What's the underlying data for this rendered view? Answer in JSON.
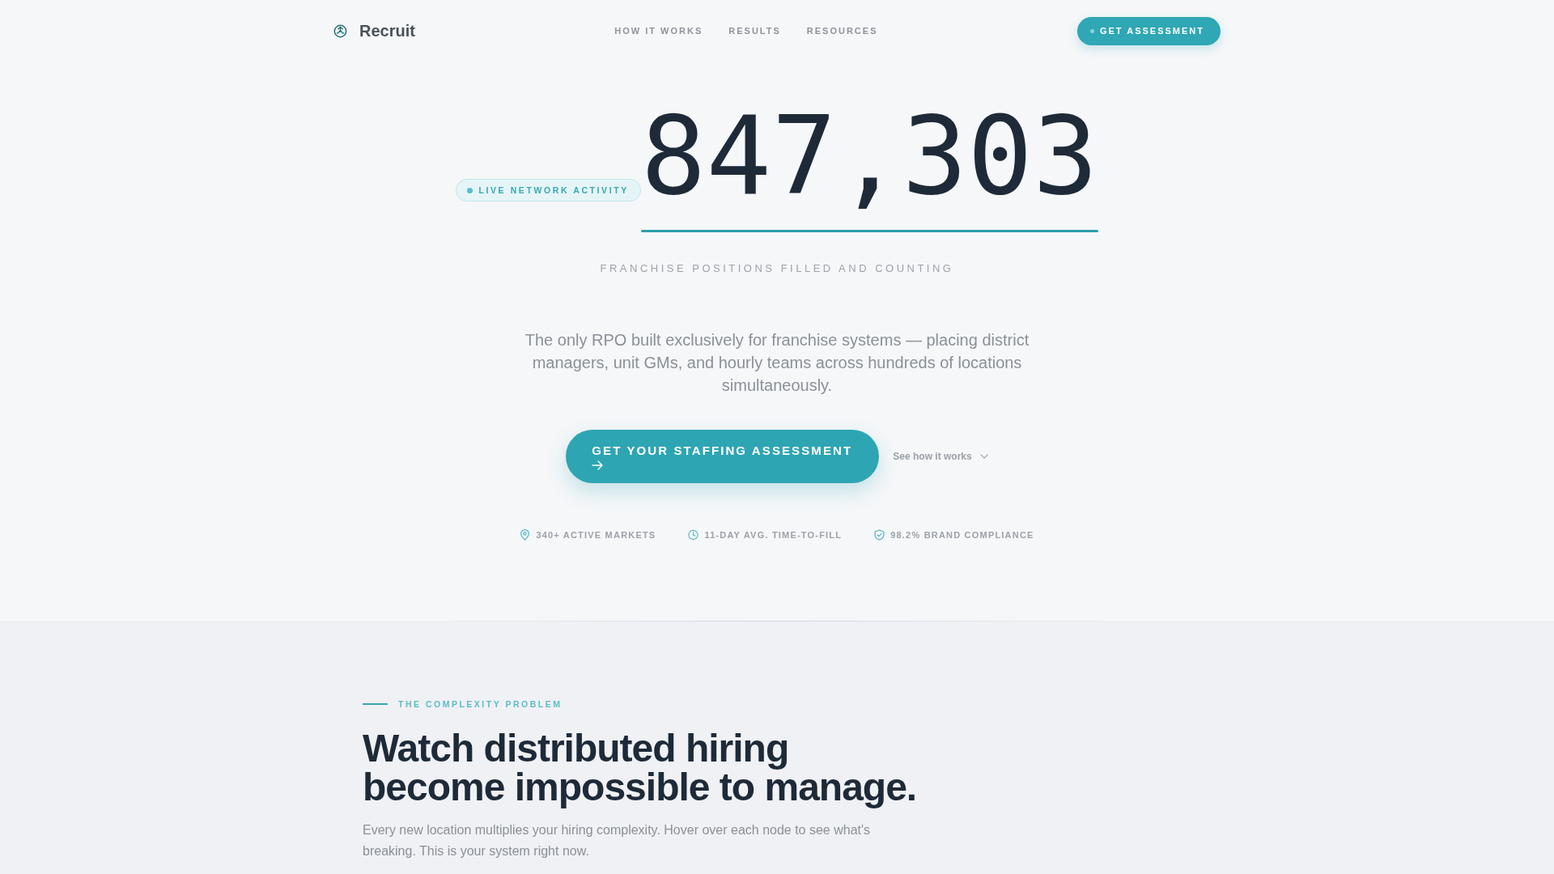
{
  "header": {
    "logo": "Recruit",
    "nav": [
      "HOW IT WORKS",
      "RESULTS",
      "RESOURCES"
    ],
    "cta": "GET ASSESSMENT"
  },
  "hero": {
    "badge": "LIVE NETWORK ACTIVITY",
    "counter": "847,303",
    "caption": "FRANCHISE POSITIONS FILLED AND COUNTING",
    "intro": "The only RPO built exclusively for franchise systems — placing district managers, unit GMs, and hourly teams across hundreds of locations simultaneously.",
    "primary_button": "GET YOUR STAFFING ASSESSMENT",
    "secondary_link": "See how it works",
    "stats": [
      "340+ ACTIVE MARKETS",
      "11-DAY AVG. TIME-TO-FILL",
      "98.2% BRAND COMPLIANCE"
    ]
  },
  "section": {
    "eyebrow": "THE COMPLEXITY PROBLEM",
    "heading": "Watch distributed hiring become impossible to manage.",
    "text": "Every new location multiplies your hiring complexity. Hover over each node to see what's breaking. This is your system right now."
  }
}
